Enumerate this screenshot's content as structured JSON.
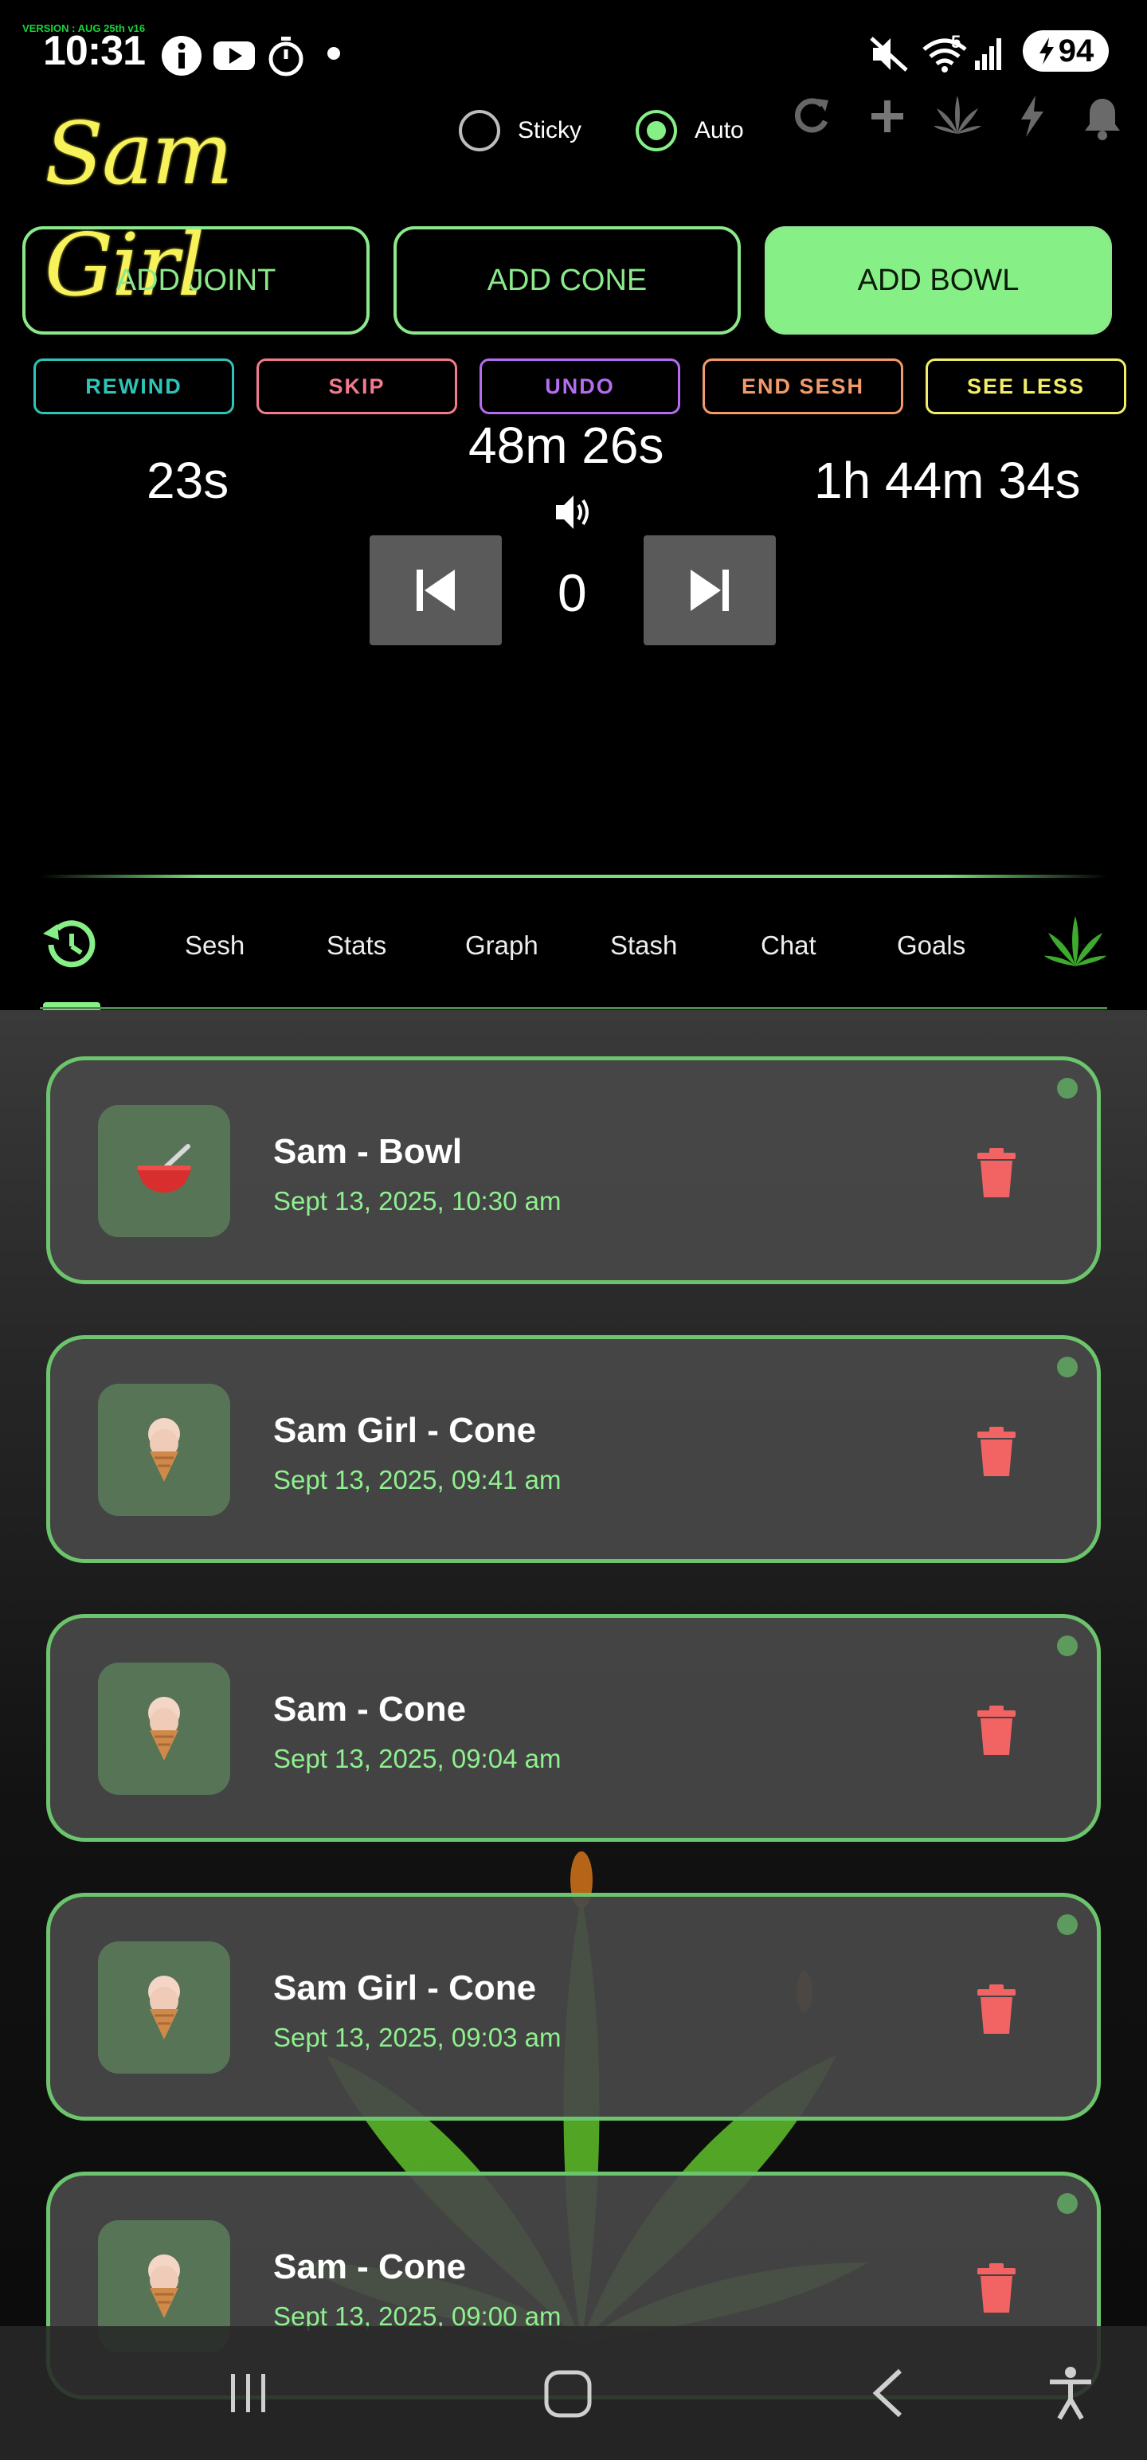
{
  "status": {
    "version": "VERSION : AUG 25th v16",
    "time": "10:31",
    "battery": "94",
    "wifi_badge": "5"
  },
  "header": {
    "logo": "Sam Girl",
    "sticky_label": "Sticky",
    "auto_label": "Auto",
    "sticky_on": false,
    "auto_on": true
  },
  "actions": {
    "add_joint": "ADD JOINT",
    "add_cone": "ADD CONE",
    "add_bowl": "ADD BOWL",
    "rewind": "REWIND",
    "skip": "SKIP",
    "undo": "UNDO",
    "end_sesh": "END SESH",
    "see_less": "SEE LESS"
  },
  "timers": {
    "left": "23s",
    "center": "48m 26s",
    "right": "1h 44m 34s",
    "counter": "0"
  },
  "tabs": [
    "Sesh",
    "Stats",
    "Graph",
    "Stash",
    "Chat",
    "Goals"
  ],
  "history": [
    {
      "title": "Sam - Bowl",
      "time": "Sept 13, 2025, 10:30 am",
      "icon": "bowl-icon"
    },
    {
      "title": "Sam Girl - Cone",
      "time": "Sept 13, 2025, 09:41 am",
      "icon": "ice-cream-cone-icon"
    },
    {
      "title": "Sam - Cone",
      "time": "Sept 13, 2025, 09:04 am",
      "icon": "ice-cream-cone-icon"
    },
    {
      "title": "Sam Girl - Cone",
      "time": "Sept 13, 2025, 09:03 am",
      "icon": "ice-cream-cone-icon"
    },
    {
      "title": "Sam - Cone",
      "time": "Sept 13, 2025, 09:00 am",
      "icon": "ice-cream-cone-icon"
    }
  ],
  "colors": {
    "accent_green": "#86ef86",
    "rewind": "#2fc4b9",
    "skip": "#f17a8e",
    "undo": "#b46cf0",
    "end_sesh": "#f39a6a",
    "see_less": "#f2ee6a",
    "trash": "#f26464"
  }
}
